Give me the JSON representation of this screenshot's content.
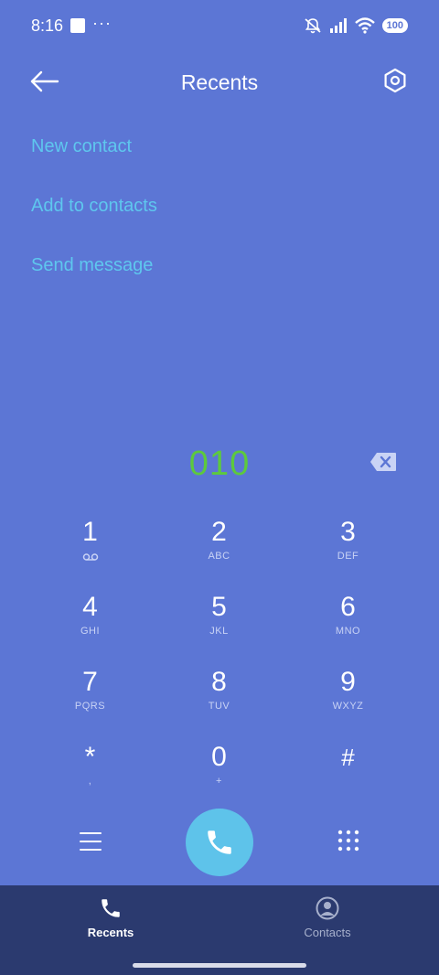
{
  "status": {
    "time": "8:16",
    "dots": "···",
    "battery": "100"
  },
  "header": {
    "title": "Recents"
  },
  "actions": {
    "new_contact": "New contact",
    "add_to_contacts": "Add to contacts",
    "send_message": "Send message"
  },
  "dialer": {
    "number": "010"
  },
  "keypad": [
    {
      "digit": "1",
      "letters": ""
    },
    {
      "digit": "2",
      "letters": "ABC"
    },
    {
      "digit": "3",
      "letters": "DEF"
    },
    {
      "digit": "4",
      "letters": "GHI"
    },
    {
      "digit": "5",
      "letters": "JKL"
    },
    {
      "digit": "6",
      "letters": "MNO"
    },
    {
      "digit": "7",
      "letters": "PQRS"
    },
    {
      "digit": "8",
      "letters": "TUV"
    },
    {
      "digit": "9",
      "letters": "WXYZ"
    },
    {
      "digit": "*",
      "letters": ","
    },
    {
      "digit": "0",
      "letters": "+"
    },
    {
      "digit": "#",
      "letters": ""
    }
  ],
  "nav": {
    "recents": "Recents",
    "contacts": "Contacts"
  },
  "colors": {
    "background": "#5c76d5",
    "accent_text": "#5ec7ee",
    "number_text": "#5dc93e",
    "call_button": "#5ec3ea",
    "nav_background": "#2b3a6f"
  },
  "icons": {
    "back": "arrow-left-icon",
    "settings": "hexagon-gear-icon",
    "backspace": "backspace-icon",
    "menu": "menu-icon",
    "call": "phone-icon",
    "dialpad": "dialpad-icon",
    "recents": "phone-icon",
    "contacts": "person-circle-icon",
    "voicemail": "voicemail-icon"
  }
}
